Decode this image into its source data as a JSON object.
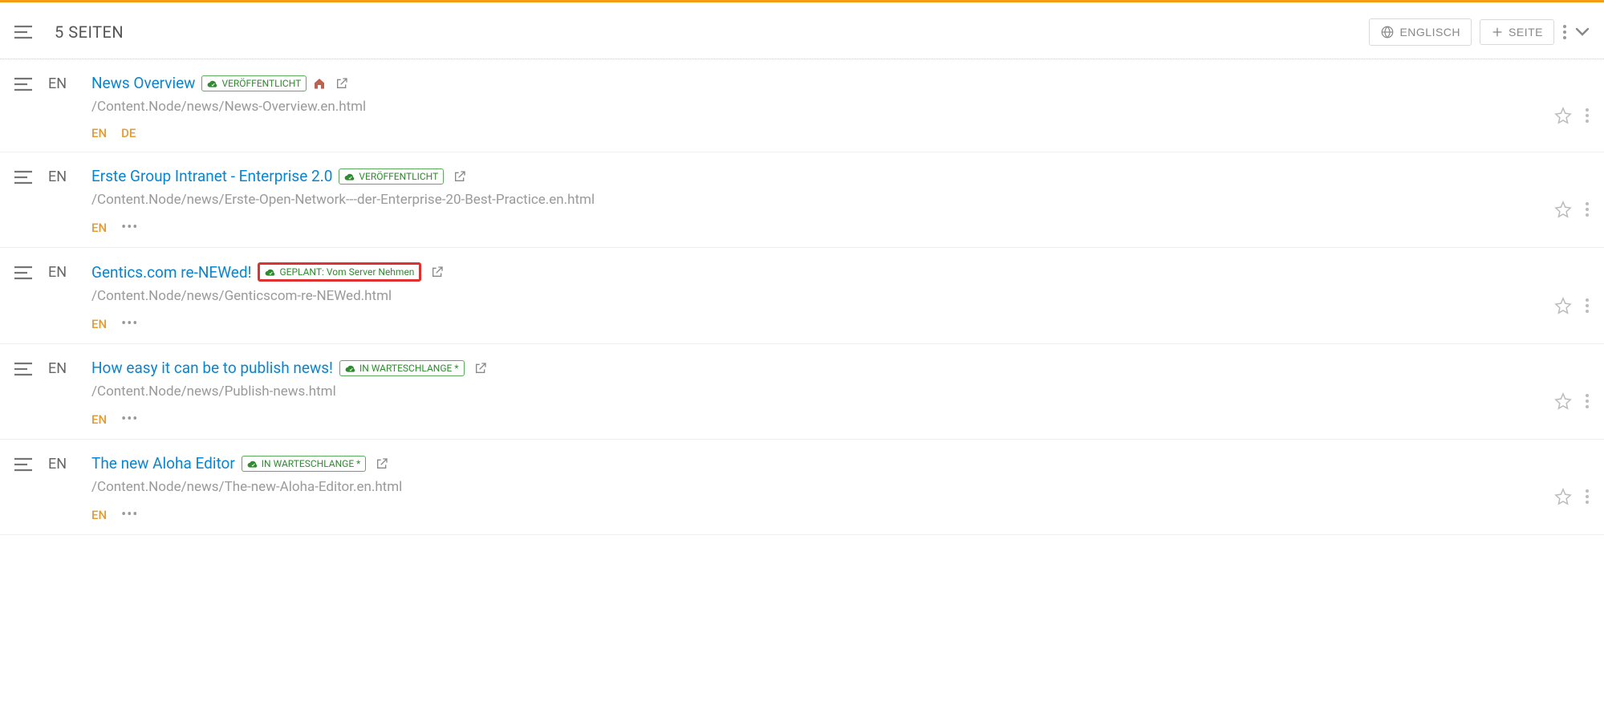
{
  "header": {
    "count_label": "5 SEITEN",
    "language_button": "ENGLISCH",
    "add_button": "SEITE"
  },
  "pages": [
    {
      "lang": "EN",
      "title": "News Overview",
      "status": "VERÖFFENTLICHT",
      "show_home": true,
      "highlight_status": false,
      "path": "/Content.Node/news/News-Overview.en.html",
      "variants": [
        "EN",
        "DE"
      ],
      "show_more_dots": false
    },
    {
      "lang": "EN",
      "title": "Erste Group Intranet - Enterprise 2.0",
      "status": "VERÖFFENTLICHT",
      "show_home": false,
      "highlight_status": false,
      "path": "/Content.Node/news/Erste-Open-Network---der-Enterprise-20-Best-Practice.en.html",
      "variants": [
        "EN"
      ],
      "show_more_dots": true
    },
    {
      "lang": "EN",
      "title": "Gentics.com re-NEWed!",
      "status": "GEPLANT: Vom Server Nehmen",
      "show_home": false,
      "highlight_status": true,
      "path": "/Content.Node/news/Genticscom-re-NEWed.html",
      "variants": [
        "EN"
      ],
      "show_more_dots": true
    },
    {
      "lang": "EN",
      "title": "How easy it can be to publish news!",
      "status": "IN WARTESCHLANGE *",
      "show_home": false,
      "highlight_status": false,
      "path": "/Content.Node/news/Publish-news.html",
      "variants": [
        "EN"
      ],
      "show_more_dots": true
    },
    {
      "lang": "EN",
      "title": "The new Aloha Editor",
      "status": "IN WARTESCHLANGE *",
      "show_home": false,
      "highlight_status": false,
      "path": "/Content.Node/news/The-new-Aloha-Editor.en.html",
      "variants": [
        "EN"
      ],
      "show_more_dots": true
    }
  ]
}
